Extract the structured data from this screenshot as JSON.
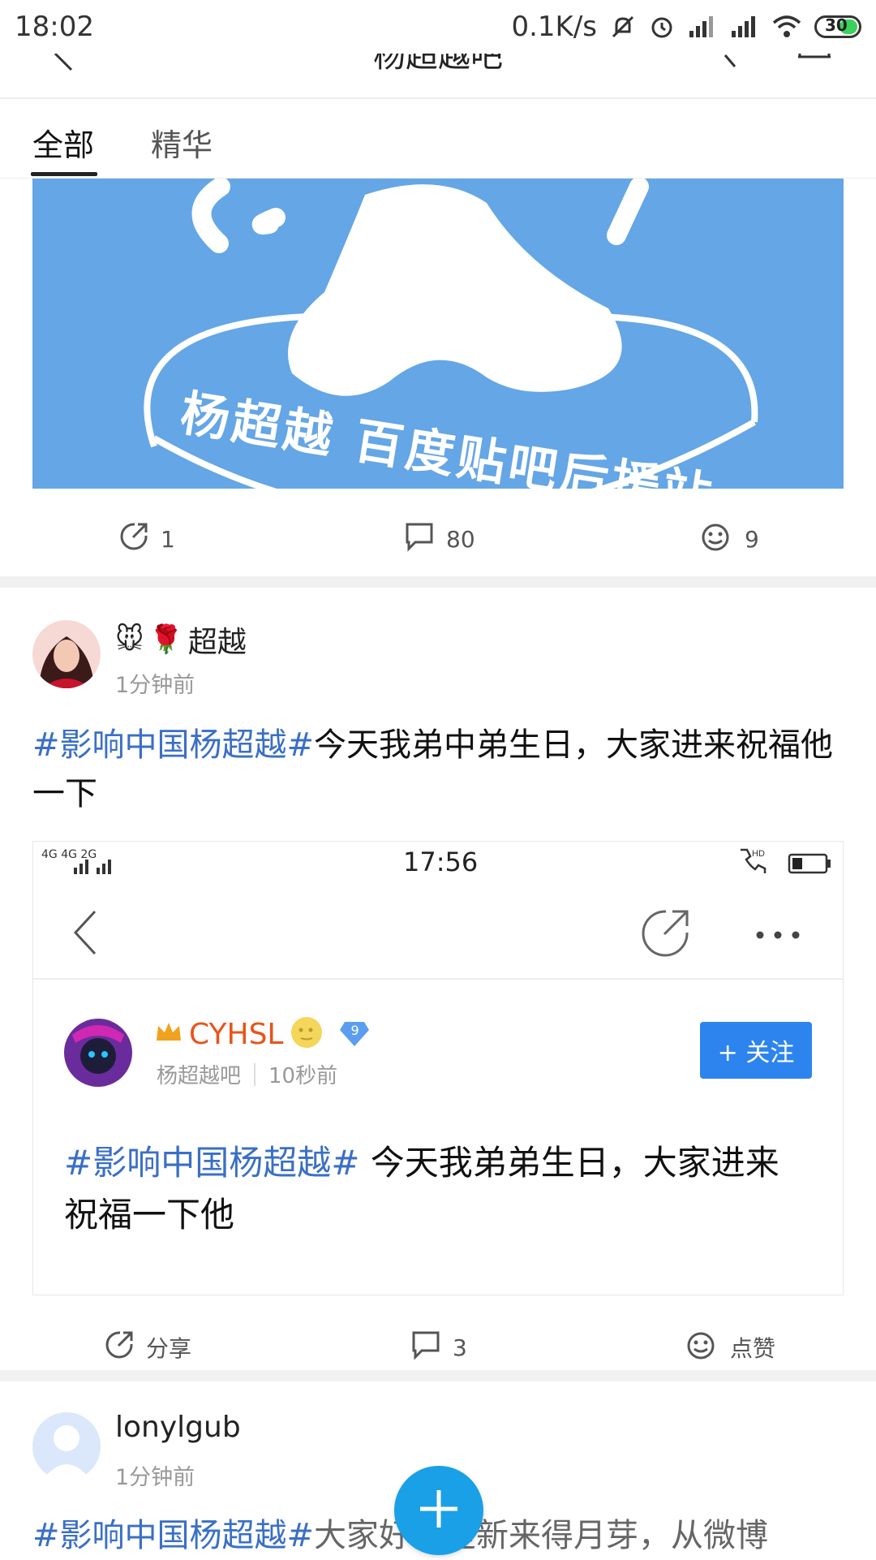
{
  "status_bar": {
    "time": "18:02",
    "network_speed": "0.1K/s",
    "battery": "30"
  },
  "header": {
    "title": "杨超越吧"
  },
  "tabs": [
    {
      "label": "全部",
      "active": true
    },
    {
      "label": "精华",
      "active": false
    }
  ],
  "post1": {
    "banner_text": "杨超越 百度贴吧后援站",
    "share_count": "1",
    "comment_count": "80",
    "like_count": "9"
  },
  "post2": {
    "username": "超越",
    "time": "1分钟前",
    "tag": "#影响中国杨超越#",
    "text": "今天我弟中弟生日，大家进来祝福他一下",
    "embedded": {
      "time": "17:56",
      "signal": "4G 4G 2G",
      "username": "CYHSL",
      "level": "9",
      "forum": "杨超越吧",
      "time_ago": "10秒前",
      "follow_label": "+ 关注",
      "tag": "#影响中国杨超越#",
      "text": " 今天我弟弟生日，大家进来祝福一下他"
    },
    "share_label": "分享",
    "comment_count": "3",
    "like_label": "点赞"
  },
  "post3": {
    "username": "lonylgub",
    "time": "1分钟前",
    "tag": "#影响中国杨超越#",
    "text": "大家好我是新来得月芽，从微博"
  },
  "colors": {
    "accent": "#1aa0e6",
    "tag": "#3a6fc6",
    "follow": "#2d84ee",
    "banner": "#64a6e6"
  }
}
